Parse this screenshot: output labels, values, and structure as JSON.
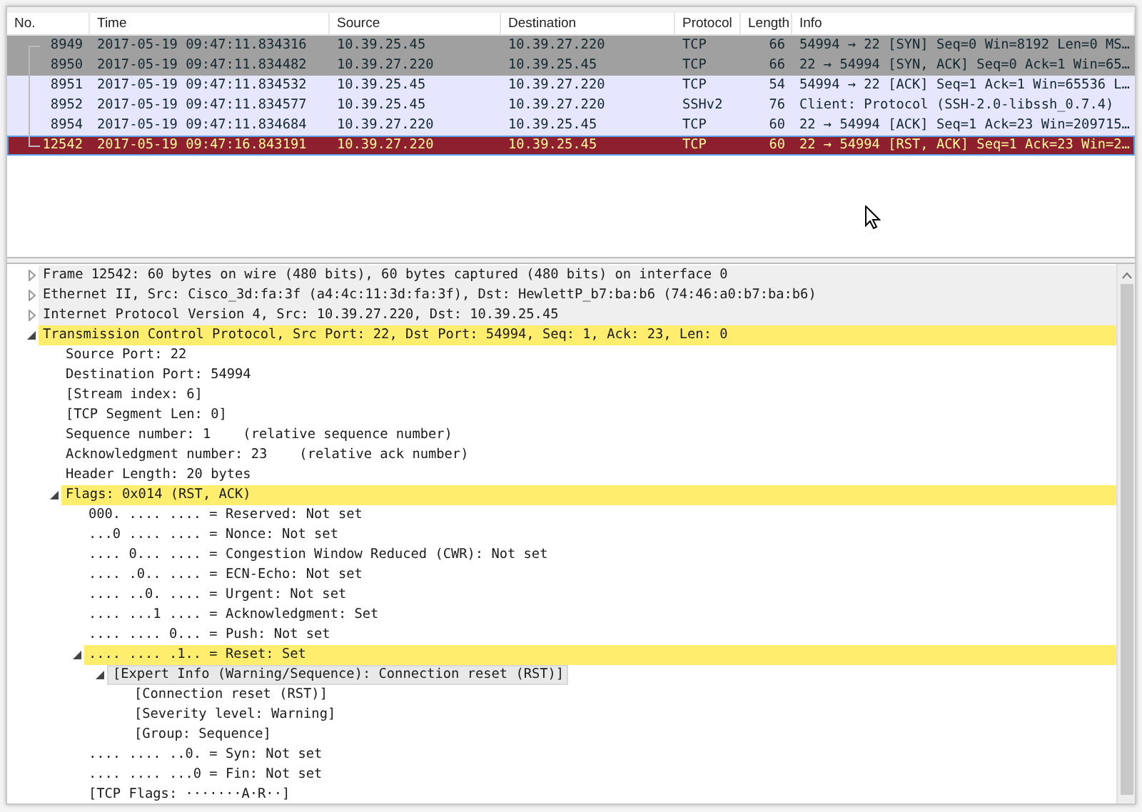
{
  "packet_list": {
    "columns": [
      "No.",
      "Time",
      "Source",
      "Destination",
      "Protocol",
      "Length",
      "Info"
    ],
    "rows": [
      {
        "cells": [
          "8949",
          "2017-05-19 09:47:11.834316",
          "10.39.25.45",
          "10.39.27.220",
          "TCP",
          "66",
          "54994 → 22 [SYN] Seq=0 Win=8192 Len=0 MS…"
        ],
        "kind": "syn",
        "selected": false
      },
      {
        "cells": [
          "8950",
          "2017-05-19 09:47:11.834482",
          "10.39.27.220",
          "10.39.25.45",
          "TCP",
          "66",
          "22 → 54994 [SYN, ACK] Seq=0 Ack=1 Win=65…"
        ],
        "kind": "syn",
        "selected": false
      },
      {
        "cells": [
          "8951",
          "2017-05-19 09:47:11.834532",
          "10.39.25.45",
          "10.39.27.220",
          "TCP",
          "54",
          "54994 → 22 [ACK] Seq=1 Ack=1 Win=65536 L…"
        ],
        "kind": "tcp",
        "selected": false
      },
      {
        "cells": [
          "8952",
          "2017-05-19 09:47:11.834577",
          "10.39.25.45",
          "10.39.27.220",
          "SSHv2",
          "76",
          "Client: Protocol (SSH-2.0-libssh_0.7.4)"
        ],
        "kind": "tcp",
        "selected": false
      },
      {
        "cells": [
          "8954",
          "2017-05-19 09:47:11.834684",
          "10.39.27.220",
          "10.39.25.45",
          "TCP",
          "60",
          "22 → 54994 [ACK] Seq=1 Ack=23 Win=209715…"
        ],
        "kind": "tcp",
        "selected": false
      },
      {
        "cells": [
          "12542",
          "2017-05-19 09:47:16.843191",
          "10.39.27.220",
          "10.39.25.45",
          "TCP",
          "60",
          "22 → 54994 [RST, ACK] Seq=1 Ack=23 Win=2…"
        ],
        "kind": "rst",
        "selected": true
      }
    ]
  },
  "details": {
    "items": [
      {
        "text": "Frame 12542: 60 bytes on wire (480 bits), 60 bytes captured (480 bits) on interface 0",
        "kind": "shaded",
        "expanded": false
      },
      {
        "text": "Ethernet II, Src: Cisco_3d:fa:3f (a4:4c:11:3d:fa:3f), Dst: HewlettP_b7:ba:b6 (74:46:a0:b7:ba:b6)",
        "kind": "shaded",
        "expanded": false
      },
      {
        "text": "Internet Protocol Version 4, Src: 10.39.27.220, Dst: 10.39.25.45",
        "kind": "shaded",
        "expanded": false
      },
      {
        "text": "Transmission Control Protocol, Src Port: 22, Dst Port: 54994, Seq: 1, Ack: 23, Len: 0",
        "kind": "marked",
        "expanded": true,
        "children": [
          {
            "text": "Source Port: 22"
          },
          {
            "text": "Destination Port: 54994"
          },
          {
            "text": "[Stream index: 6]"
          },
          {
            "text": "[TCP Segment Len: 0]"
          },
          {
            "text": "Sequence number: 1    (relative sequence number)"
          },
          {
            "text": "Acknowledgment number: 23    (relative ack number)"
          },
          {
            "text": "Header Length: 20 bytes"
          },
          {
            "text": "Flags: 0x014 (RST, ACK)",
            "kind": "marked",
            "expanded": true,
            "children": [
              {
                "text": "000. .... .... = Reserved: Not set"
              },
              {
                "text": "...0 .... .... = Nonce: Not set"
              },
              {
                "text": ".... 0... .... = Congestion Window Reduced (CWR): Not set"
              },
              {
                "text": ".... .0.. .... = ECN-Echo: Not set"
              },
              {
                "text": ".... ..0. .... = Urgent: Not set"
              },
              {
                "text": ".... ...1 .... = Acknowledgment: Set"
              },
              {
                "text": ".... .... 0... = Push: Not set"
              },
              {
                "text": ".... .... .1.. = Reset: Set",
                "kind": "marked",
                "expanded": true,
                "children": [
                  {
                    "text": "[Expert Info (Warning/Sequence): Connection reset (RST)]",
                    "kind": "expert",
                    "expanded": true,
                    "children": [
                      {
                        "text": "[Connection reset (RST)]"
                      },
                      {
                        "text": "[Severity level: Warning]"
                      },
                      {
                        "text": "[Group: Sequence]"
                      }
                    ]
                  }
                ]
              },
              {
                "text": ".... .... ..0. = Syn: Not set"
              },
              {
                "text": ".... .... ...0 = Fin: Not set"
              },
              {
                "text": "[TCP Flags: ·······A·R··]"
              }
            ]
          }
        ]
      }
    ]
  }
}
